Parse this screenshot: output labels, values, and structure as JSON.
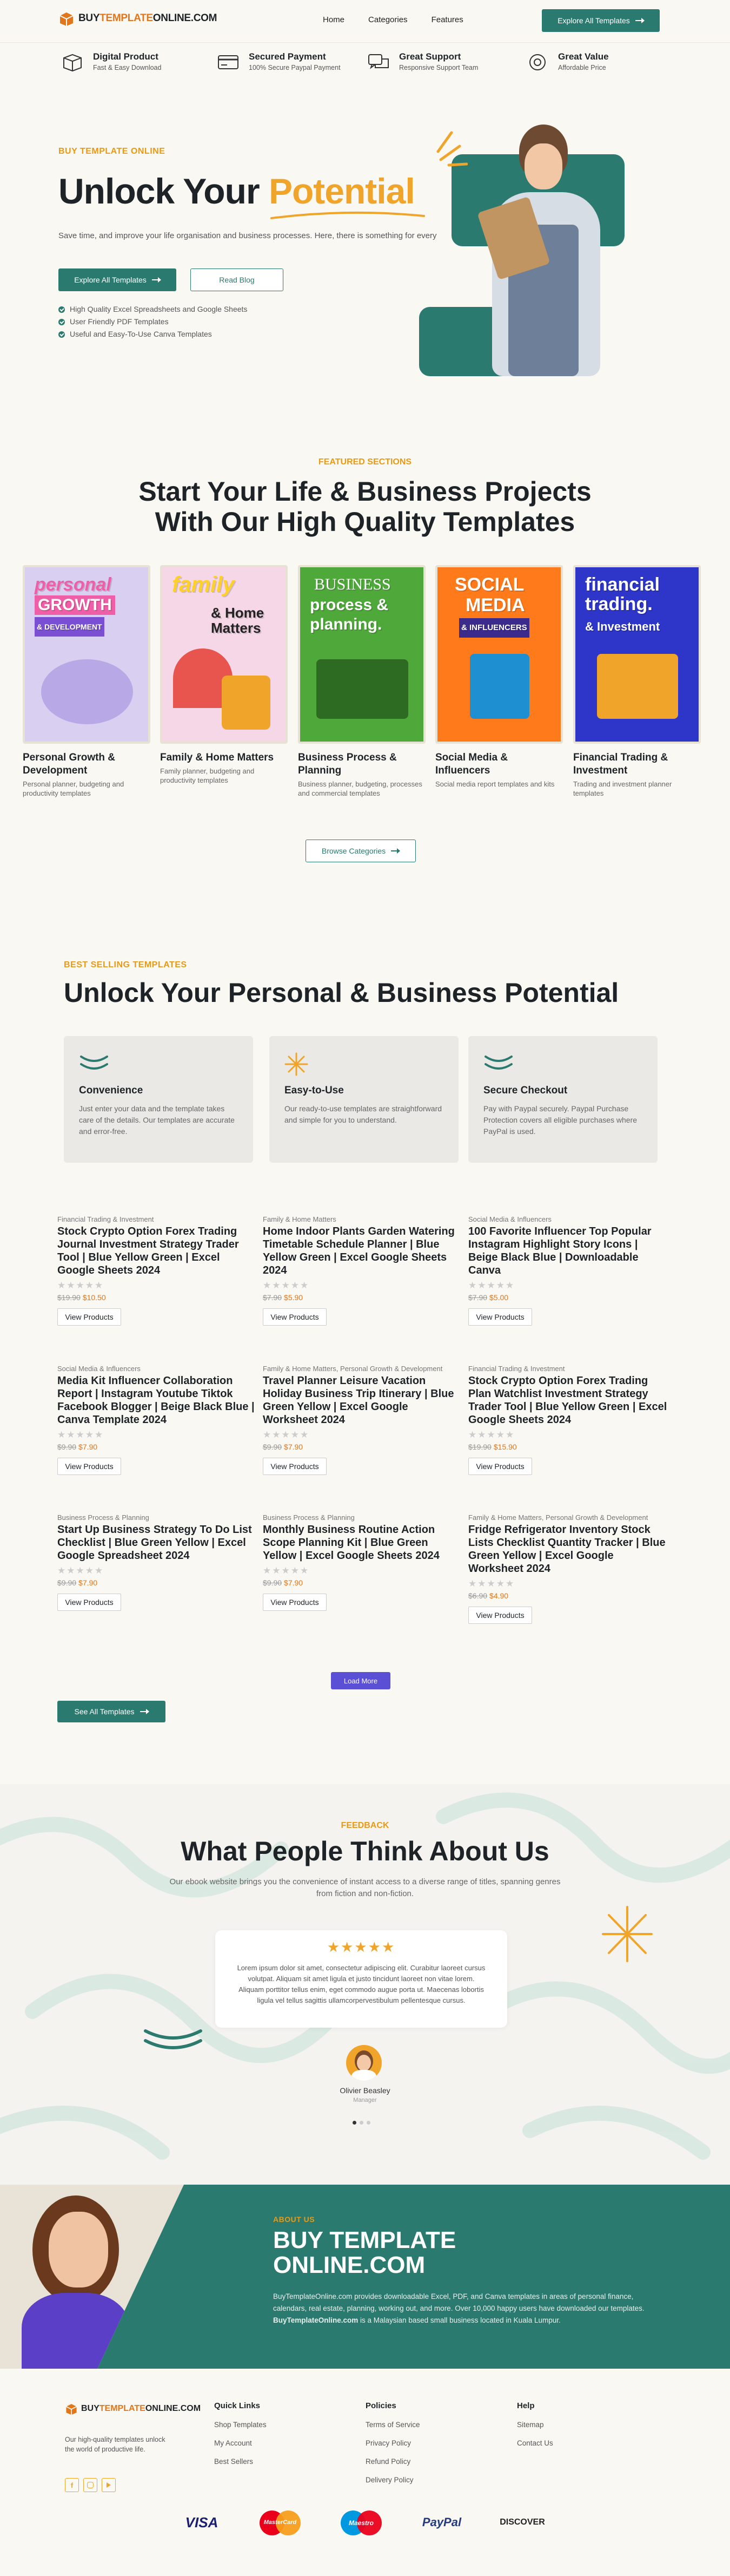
{
  "header": {
    "logo": {
      "part1": "BUY",
      "part2": "TEMPLATE",
      "part3": "ONLINE.COM"
    },
    "nav": [
      "Home",
      "Categories",
      "Features"
    ],
    "cta": "Explore All Templates"
  },
  "features": [
    {
      "icon": "box-icon",
      "title": "Digital Product",
      "sub": "Fast & Easy Download"
    },
    {
      "icon": "card-icon",
      "title": "Secured Payment",
      "sub": "100% Secure Paypal Payment"
    },
    {
      "icon": "chat-icon",
      "title": "Great Support",
      "sub": "Responsive Support Team"
    },
    {
      "icon": "value-icon",
      "title": "Great Value",
      "sub": "Affordable Price"
    }
  ],
  "hero": {
    "kicker": "BUY TEMPLATE ONLINE",
    "title_a": "Unlock Your ",
    "title_b": "Potential",
    "desc": "Save time, and improve your life organisation and business processes. Here, there is something for everyone.",
    "btn_primary": "Explore All Templates",
    "btn_secondary": "Read Blog",
    "checks": [
      "High Quality Excel Spreadsheets and Google Sheets",
      "User Friendly PDF Templates",
      "Useful and Easy-To-Use Canva Templates"
    ]
  },
  "featured": {
    "kicker": "FEATURED SECTIONS",
    "title_l1": "Start Your Life & Business Projects",
    "title_l2": "With Our High Quality Templates",
    "categories": [
      {
        "img_a": "personal",
        "img_b": "GROWTH",
        "img_c": "& DEVELOPMENT",
        "name": "Personal Growth & Development",
        "desc": "Personal planner, budgeting and productivity templates"
      },
      {
        "img_a": "family",
        "img_b": "& Home Matters",
        "img_c": "",
        "name": "Family & Home Matters",
        "desc": "Family planner, budgeting and productivity templates"
      },
      {
        "img_a": "BUSINESS",
        "img_b": "process &",
        "img_c": "planning.",
        "name": "Business Process & Planning",
        "desc": "Business planner, budgeting, processes and commercial templates"
      },
      {
        "img_a": "SOCIAL",
        "img_b": "MEDIA",
        "img_c": "& INFLUENCERS",
        "name": "Social Media & Influencers",
        "desc": "Social media report templates and kits"
      },
      {
        "img_a": "financial",
        "img_b": "trading.",
        "img_c": "& Investment",
        "name": "Financial Trading & Investment",
        "desc": "Trading and investment planner templates"
      }
    ],
    "browse": "Browse Categories"
  },
  "best": {
    "kicker": "BEST SELLING TEMPLATES",
    "title": "Unlock Your Personal & Business Potential",
    "cards": [
      {
        "icon": "wave-icon",
        "title": "Convenience",
        "desc": "Just enter your data and the template takes care of the details. Our templates are accurate and error-free."
      },
      {
        "icon": "star-burst-icon",
        "title": "Easy-to-Use",
        "desc": "Our ready-to-use templates are straightforward and simple for you to understand."
      },
      {
        "icon": "wave-icon",
        "title": "Secure Checkout",
        "desc": "Pay with Paypal securely. Paypal Purchase Protection covers all eligible purchases where PayPal is used."
      }
    ],
    "products": [
      {
        "cat": "Financial Trading & Investment",
        "title": "Stock Crypto Option Forex Trading Journal Investment Strategy Trader Tool | Blue Yellow Green | Excel Google Sheets 2024",
        "old": "$19.90",
        "new": "$10.50"
      },
      {
        "cat": "Family & Home Matters",
        "title": "Home Indoor Plants Garden Watering Timetable Schedule Planner | Blue Yellow Green | Excel Google Sheets 2024",
        "old": "$7.90",
        "new": "$5.90"
      },
      {
        "cat": "Social Media & Influencers",
        "title": "100 Favorite Influencer Top Popular Instagram Highlight Story Icons | Beige Black Blue | Downloadable Canva",
        "old": "$7.90",
        "new": "$5.00"
      },
      {
        "cat": "Social Media & Influencers",
        "title": "Media Kit Influencer Collaboration Report | Instagram Youtube Tiktok Facebook Blogger | Beige Black Blue | Canva Template 2024",
        "old": "$9.90",
        "new": "$7.90"
      },
      {
        "cat": "Family & Home Matters, Personal Growth & Development",
        "title": "Travel Planner Leisure Vacation Holiday Business Trip Itinerary | Blue Green Yellow | Excel Google Worksheet 2024",
        "old": "$9.90",
        "new": "$7.90"
      },
      {
        "cat": "Financial Trading & Investment",
        "title": "Stock Crypto Option Forex Trading Plan Watchlist Investment Strategy Trader Tool | Blue Yellow Green | Excel Google Sheets 2024",
        "old": "$19.90",
        "new": "$15.90"
      },
      {
        "cat": "Business Process & Planning",
        "title": "Start Up Business Strategy To Do List Checklist | Blue Green Yellow | Excel Google Spreadsheet 2024",
        "old": "$9.90",
        "new": "$7.90"
      },
      {
        "cat": "Business Process & Planning",
        "title": "Monthly Business Routine Action Scope Planning Kit | Blue Green Yellow | Excel Google Sheets 2024",
        "old": "$9.90",
        "new": "$7.90"
      },
      {
        "cat": "Family & Home Matters, Personal Growth & Development",
        "title": "Fridge Refrigerator Inventory Stock Lists Checklist Quantity Tracker | Blue Green Yellow | Excel Google Worksheet 2024",
        "old": "$6.90",
        "new": "$4.90"
      }
    ],
    "view_label": "View Products",
    "load_more": "Load More",
    "see_all": "See All Templates"
  },
  "testimonials": {
    "kicker": "FEEDBACK",
    "title": "What People Think About Us",
    "desc": "Our ebook website brings you the convenience of instant access to a diverse range of titles, spanning genres from fiction and non-fiction.",
    "stars": "★★★★★",
    "quote": "Lorem ipsum dolor sit amet, consectetur adipiscing elit. Curabitur laoreet cursus volutpat. Aliquam sit amet ligula et justo tincidunt laoreet non vitae lorem. Aliquam porttitor tellus enim, eget commodo augue porta ut. Maecenas lobortis ligula vel tellus sagittis ullamcorpervestibulum pellentesque cursus.",
    "name": "Olivier Beasley",
    "role": "Manager"
  },
  "about": {
    "kicker": "ABOUT US",
    "title_l1": "BUY TEMPLATE",
    "title_l2": "ONLINE.COM",
    "desc_a": "BuyTemplateOnline.com provides downloadable Excel, PDF, and Canva templates in areas of personal finance, calendars, real estate, planning, working out, and more. Over 10,000 happy users have downloaded our templates. ",
    "desc_b": "BuyTemplateOnline.com",
    "desc_c": " is a Malaysian based small business located in Kuala Lumpur."
  },
  "footer": {
    "tagline": "Our high-quality templates unlock the world of productive life.",
    "cols": [
      {
        "h": "Quick Links",
        "links": [
          "Shop Templates",
          "My Account",
          "Best Sellers"
        ]
      },
      {
        "h": "Policies",
        "links": [
          "Terms of Service",
          "Privacy Policy",
          "Refund Policy",
          "Delivery Policy"
        ]
      },
      {
        "h": "Help",
        "links": [
          "Sitemap",
          "Contact Us"
        ]
      }
    ],
    "payments": [
      "VISA",
      "MasterCard",
      "Maestro",
      "PayPal",
      "DISCOVER"
    ]
  },
  "colors": {
    "teal": "#2b7a6f",
    "orange": "#f0a52a",
    "purple": "#6a5acd",
    "bg": "#faf8f3"
  }
}
